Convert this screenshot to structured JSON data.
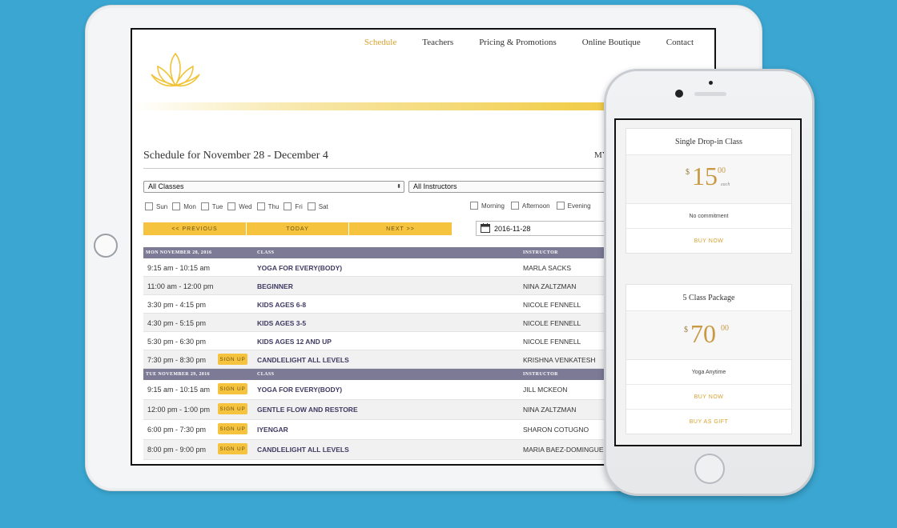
{
  "nav": {
    "items": [
      "Schedule",
      "Teachers",
      "Pricing & Promotions",
      "Online Boutique",
      "Contact"
    ],
    "active": "Schedule"
  },
  "schedule": {
    "title": "Schedule for November 28 - December 4",
    "my_link": "MY",
    "class_filter": "All Classes",
    "instructor_filter": "All Instructors",
    "days": [
      "Sun",
      "Mon",
      "Tue",
      "Wed",
      "Thu",
      "Fri",
      "Sat"
    ],
    "times": [
      "Morning",
      "Afternoon",
      "Evening"
    ],
    "prev_label": "<< PREVIOUS",
    "today_label": "TODAY",
    "next_label": "NEXT >>",
    "date_value": "2016-11-28"
  },
  "table": {
    "col_class": "CLASS",
    "col_instructor": "INSTRUCTOR",
    "signup_label": "SIGN UP",
    "day1": {
      "header": "MON NOVEMBER 28, 2016",
      "rows": [
        {
          "time": "9:15 am - 10:15 am",
          "class": "YOGA FOR EVERY(BODY)",
          "instructor": "MARLA SACKS"
        },
        {
          "time": "11:00 am - 12:00 pm",
          "class": "BEGINNER",
          "instructor": "NINA ZALTZMAN"
        },
        {
          "time": "3:30 pm - 4:15 pm",
          "class": "KIDS AGES 6-8",
          "instructor": "NICOLE FENNELL"
        },
        {
          "time": "4:30 pm - 5:15 pm",
          "class": "KIDS AGES 3-5",
          "instructor": "NICOLE FENNELL"
        },
        {
          "time": "5:30 pm - 6:30 pm",
          "class": "KIDS AGES 12 AND UP",
          "instructor": "NICOLE FENNELL"
        },
        {
          "time": "7:30 pm - 8:30 pm",
          "class": "CANDLELIGHT ALL LEVELS",
          "instructor": "KRISHNA VENKATESH"
        }
      ]
    },
    "day2": {
      "header": "TUE NOVEMBER 29, 2016",
      "rows": [
        {
          "time": "9:15 am - 10:15 am",
          "class": "YOGA FOR EVERY(BODY)",
          "instructor": "JILL MCKEON"
        },
        {
          "time": "12:00 pm - 1:00 pm",
          "class": "GENTLE FLOW AND RESTORE",
          "instructor": "NINA ZALTZMAN"
        },
        {
          "time": "6:00 pm - 7:30 pm",
          "class": "IYENGAR",
          "instructor": "SHARON COTUGNO"
        },
        {
          "time": "8:00 pm - 9:00 pm",
          "class": "CANDLELIGHT ALL LEVELS",
          "instructor": "MARIA BAEZ-DOMINGUE"
        }
      ]
    }
  },
  "pricing": {
    "card1": {
      "title": "Single Drop-in Class",
      "currency": "$",
      "amount": "15",
      "cents": "00",
      "unit": "each",
      "note": "No commitment",
      "buy": "BUY NOW"
    },
    "card2": {
      "title": "5 Class Package",
      "currency": "$",
      "amount": "70",
      "cents": "00",
      "note": "Yoga Anytime",
      "buy": "BUY NOW",
      "gift": "BUY AS GIFT"
    }
  },
  "colors": {
    "background": "#3aa6d1",
    "accent": "#f6c33e",
    "header": "#7c7a95",
    "gold_text": "#c99a44"
  }
}
